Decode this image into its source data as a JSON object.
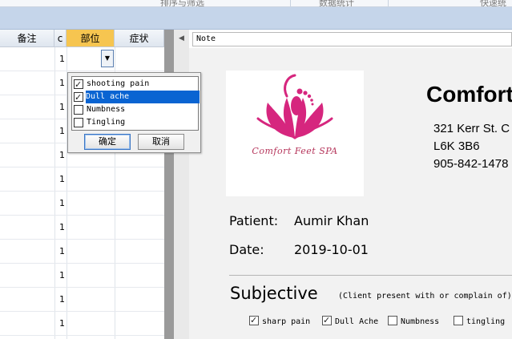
{
  "ribbon": {
    "groups": [
      "排序与筛选",
      "数据统计",
      "快速统"
    ]
  },
  "grid": {
    "headers": [
      "备注",
      "c",
      "部位",
      "症状"
    ],
    "row_values": [
      "1",
      "1",
      "1",
      "1",
      "1",
      "1",
      "1",
      "1",
      "1",
      "1",
      "1",
      "1"
    ]
  },
  "icons": {
    "dropdown": "chevron-down-icon",
    "collapse": "collapse-left-icon",
    "check": "checkmark-icon"
  },
  "popup": {
    "items": [
      {
        "label": "shooting pain",
        "checked": true
      },
      {
        "label": "Dull ache",
        "checked": true
      },
      {
        "label": "Numbness",
        "checked": false
      },
      {
        "label": "Tingling",
        "checked": false
      }
    ],
    "selected_index": 1,
    "ok_label": "确定",
    "cancel_label": "取消"
  },
  "note_bar": {
    "label": "Note"
  },
  "document": {
    "logo_text": "Comfort Feet SPA",
    "company_name": "Comfort",
    "address": [
      "321 Kerr St. C",
      "L6K 3B6",
      "905-842-1478"
    ],
    "patient_label": "Patient:",
    "patient_value": "Aumir Khan",
    "date_label": "Date:",
    "date_value": "2019-10-01",
    "section_title": "Subjective",
    "section_note": "(Client present with or complain of)",
    "symptoms": [
      {
        "label": "sharp pain",
        "checked": true
      },
      {
        "label": "Dull Ache",
        "checked": true
      },
      {
        "label": "Numbness",
        "checked": false
      },
      {
        "label": "tingling",
        "checked": false
      }
    ]
  },
  "colors": {
    "active_header": "#f6c550",
    "selection": "#0a64d2",
    "logo_magenta": "#d6267e",
    "ribbon_band": "#c5d5ea"
  }
}
